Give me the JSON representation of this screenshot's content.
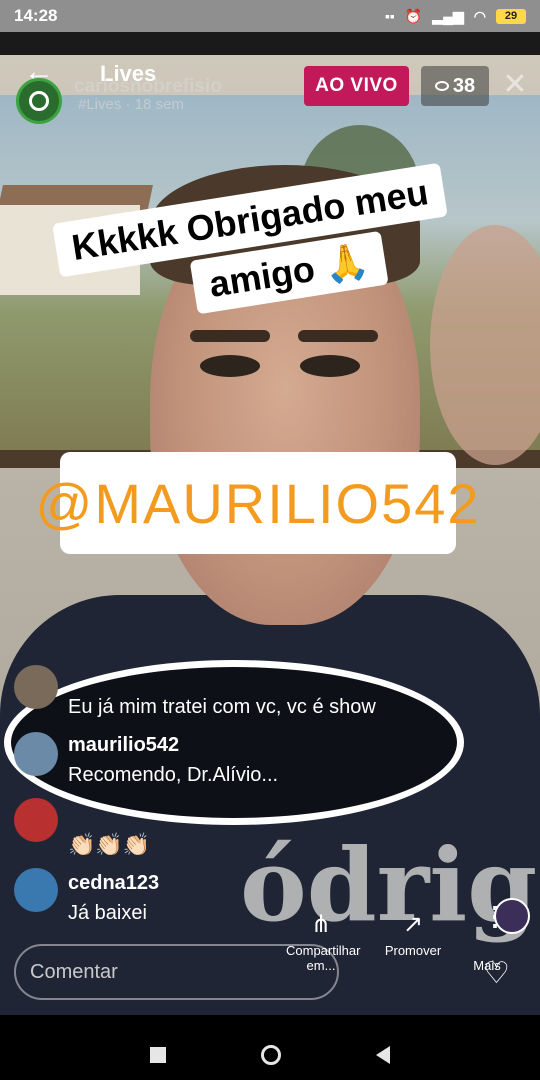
{
  "status_bar": {
    "time": "14:28",
    "battery": "29"
  },
  "header": {
    "title": "Lives",
    "host_name": "carlosnobrefisio",
    "host_sub": "#Lives · 18 sem",
    "live_label": "AO VIVO",
    "viewer_count": "38"
  },
  "stickers": {
    "line1": "Kkkkk Obrigado meu",
    "line2": "amigo 🙏",
    "mention": "@MAURILIO542"
  },
  "comments": [
    {
      "user": "",
      "text": "Eu já mim tratei com vc, vc é show"
    },
    {
      "user": "maurilio542",
      "text": "Recomendo, Dr.Alívio..."
    },
    {
      "user": "",
      "text": "👏🏻👏🏻👏🏻"
    },
    {
      "user": "cedna123",
      "text": "Já baixei"
    }
  ],
  "bottom": {
    "comment_placeholder": "Comentar",
    "share_label": "Compartilhar em...",
    "promote_label": "Promover",
    "more_label": "Mais"
  }
}
